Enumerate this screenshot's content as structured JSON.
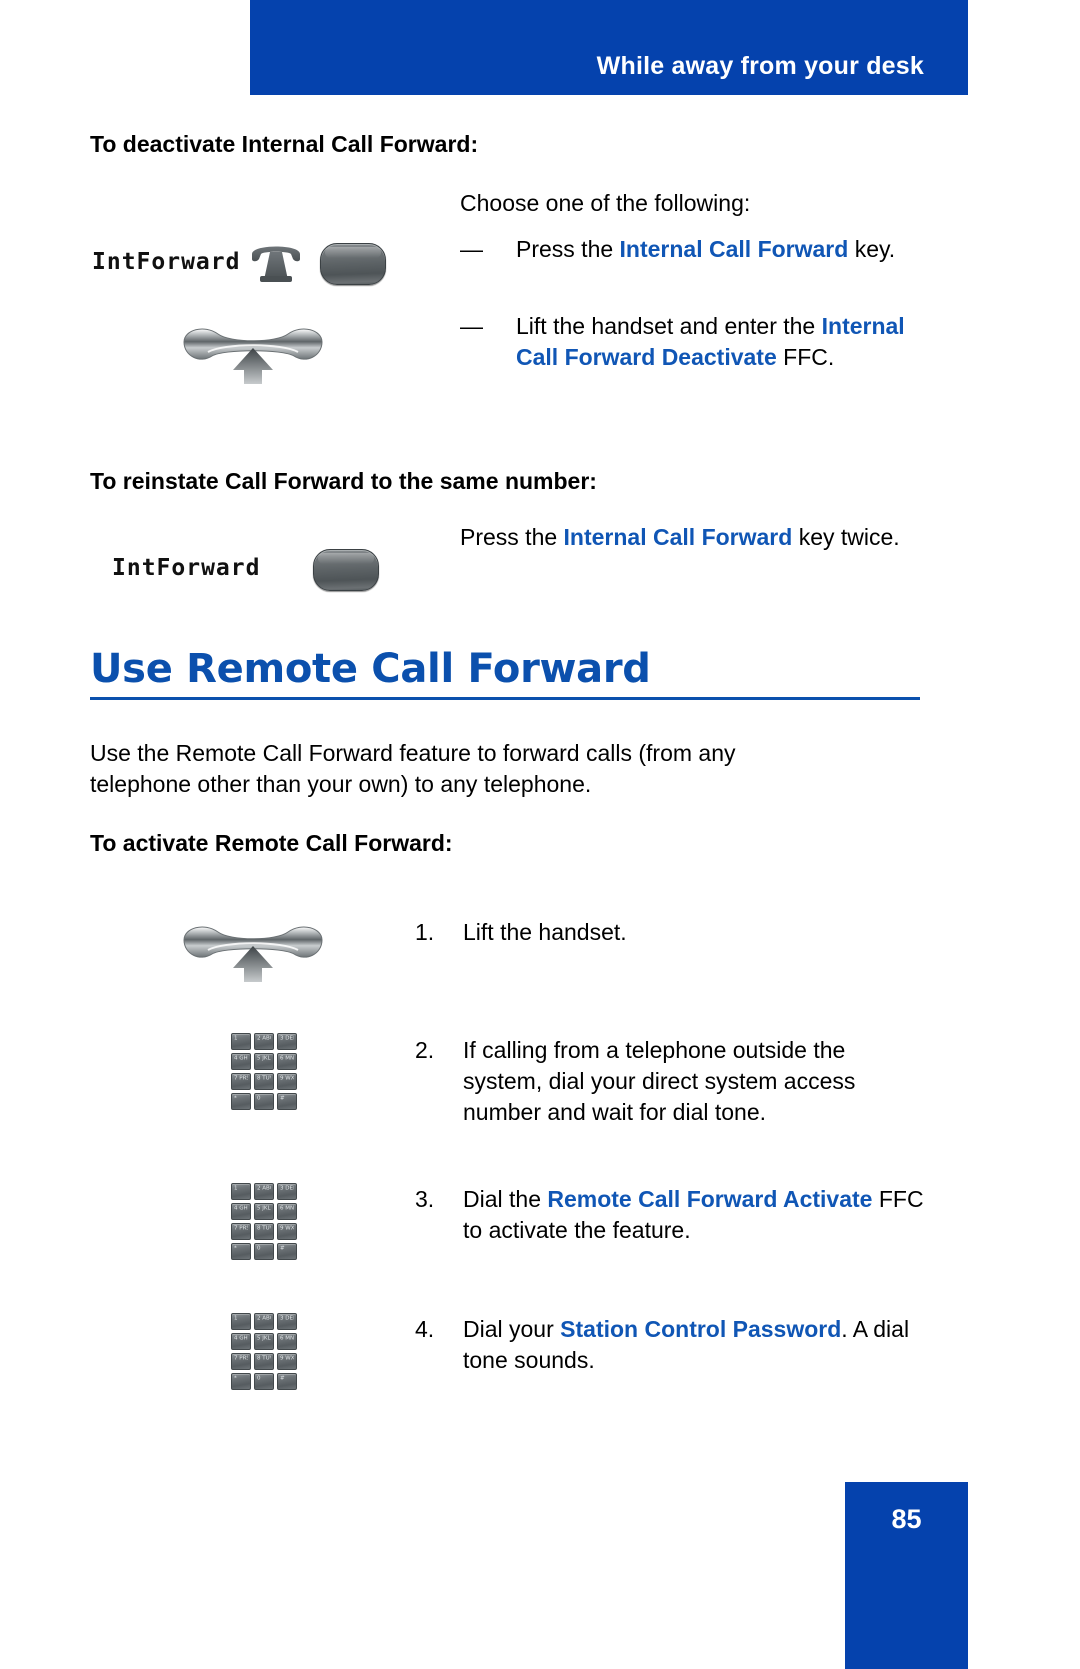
{
  "header": {
    "running_title": "While away from your desk",
    "bar_color": "#0542AD"
  },
  "colors": {
    "accent_blue": "#1056B5",
    "heading_blue": "#0B50AD",
    "header_blue": "#0542AD"
  },
  "sections": [
    {
      "id": "deactivate-internal-call-forward",
      "heading": "To deactivate Internal Call Forward:",
      "intro": "Choose one of the following:",
      "bullets": [
        {
          "marker": "—",
          "parts": [
            {
              "text": "Press the ",
              "bold": false
            },
            {
              "text": "Internal Call Forward",
              "bold": true
            },
            {
              "text": " key.",
              "bold": false
            }
          ]
        },
        {
          "marker": "—",
          "parts": [
            {
              "text": "Lift the handset and enter the ",
              "bold": false
            },
            {
              "text": "Internal Call Forward Deactivate",
              "bold": true
            },
            {
              "text": " FFC.",
              "bold": false
            }
          ]
        }
      ],
      "icons": {
        "soft_label": "IntForward",
        "telephone_icon": "telephone-icon",
        "feature_key_icon": "feature-key-icon",
        "handset_icon": "handset-lift-icon"
      }
    },
    {
      "id": "reinstate-call-forward",
      "heading": "To reinstate Call Forward to the same number:",
      "icons": {
        "soft_label": "IntForward",
        "feature_key_icon": "feature-key-icon"
      },
      "body_parts": [
        {
          "text": "Press the ",
          "bold": false
        },
        {
          "text": "Internal Call Forward",
          "bold": true
        },
        {
          "text": " key twice.",
          "bold": false
        }
      ]
    }
  ],
  "main_section": {
    "title": "Use Remote Call Forward",
    "paragraph": "Use the Remote Call Forward feature to forward calls (from any telephone other than your own) to any telephone.",
    "sub_heading": "To activate Remote Call Forward:",
    "steps": [
      {
        "number": "1.",
        "icon": "handset-lift-icon",
        "parts": [
          {
            "text": "Lift the handset.",
            "bold": false
          }
        ]
      },
      {
        "number": "2.",
        "icon": "dial-pad-icon",
        "parts": [
          {
            "text": "If calling from a telephone outside the system, dial your direct system access number and wait for dial tone.",
            "bold": false
          }
        ]
      },
      {
        "number": "3.",
        "icon": "dial-pad-icon",
        "parts": [
          {
            "text": "Dial the ",
            "bold": false
          },
          {
            "text": "Remote Call Forward Activate",
            "bold": true
          },
          {
            "text": " FFC to activate the feature.",
            "bold": false
          }
        ]
      },
      {
        "number": "4.",
        "icon": "dial-pad-icon",
        "parts": [
          {
            "text": "Dial your ",
            "bold": false
          },
          {
            "text": "Station Control Password",
            "bold": true
          },
          {
            "text": ". A dial tone sounds.",
            "bold": false
          }
        ]
      }
    ]
  },
  "dial_pad": {
    "keys": [
      "1",
      "2 ABC",
      "3 DEF",
      "4 GHI",
      "5 JKL",
      "6 MNO",
      "7 PRS",
      "8 TUV",
      "9 WXY",
      "*",
      "0",
      "#"
    ]
  },
  "footer": {
    "page_number": "85"
  }
}
